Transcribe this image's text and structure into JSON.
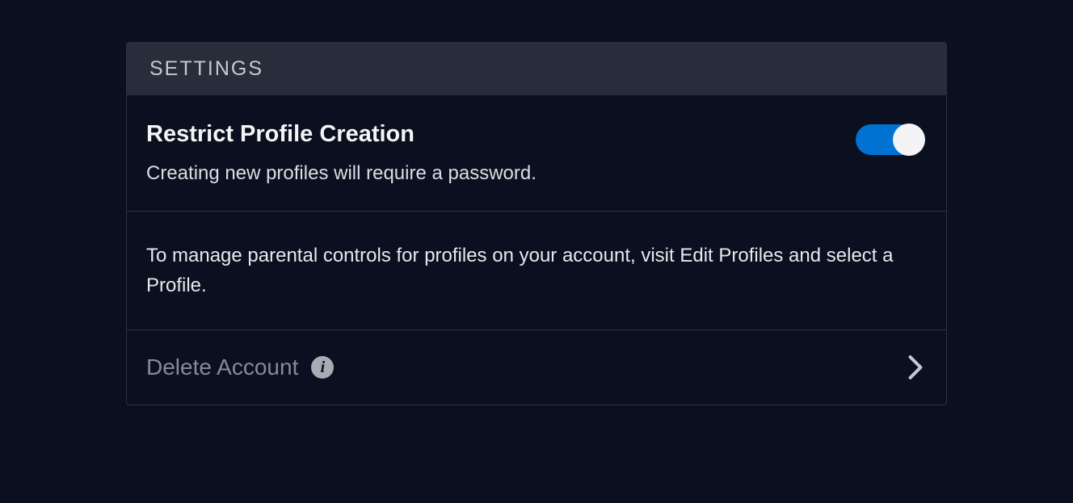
{
  "panel": {
    "header_title": "SETTINGS",
    "restrict": {
      "title": "Restrict Profile Creation",
      "description": "Creating new profiles will require a password.",
      "enabled": true
    },
    "parental_info": "To manage parental controls for profiles on your account, visit Edit Profiles and select a Profile.",
    "delete": {
      "label": "Delete Account"
    }
  }
}
